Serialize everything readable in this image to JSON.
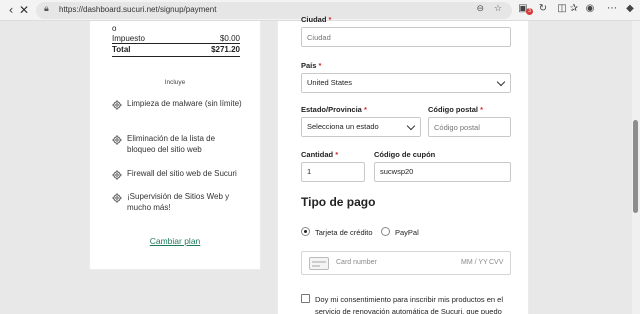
{
  "browser": {
    "url": "https://dashboard.sucuri.net/signup/payment",
    "notification_count": "3"
  },
  "summary": {
    "partial_top": "o",
    "tax_label": "Impuesto",
    "tax_value": "$0.00",
    "total_label": "Total",
    "total_value": "$271.20",
    "includes_label": "Incluye",
    "features": [
      {
        "text": "Limpieza de malware (sin límite)"
      },
      {
        "text": "Eliminación de la lista de bloqueo del sitio web"
      },
      {
        "text": "Firewall del sitio web de Sucuri"
      },
      {
        "text": "¡Supervisión de Sitios Web y mucho más!"
      }
    ],
    "change_plan": "Cambiar plan"
  },
  "form": {
    "city_label": "Ciudad",
    "city_placeholder": "Ciudad",
    "country_label": "País",
    "country_value": "United States",
    "state_label": "Estado/Provincia",
    "state_value": "Selecciona un estado",
    "postal_label": "Código postal",
    "postal_placeholder": "Código postal",
    "quantity_label": "Cantidad",
    "quantity_value": "1",
    "coupon_label": "Código de cupón",
    "coupon_value": "sucwsp20",
    "payment_title": "Tipo de pago",
    "credit_card_label": "Tarjeta de crédito",
    "paypal_label": "PayPal",
    "card_number_placeholder": "Card number",
    "expiry_placeholder": "MM / YY",
    "cvv_placeholder": "CVV",
    "consent_text": "Doy mi consentimiento para inscribir mis productos en el servicio de renovación automática de Sucuri, que puedo"
  },
  "colors": {
    "link": "#1f7a5a",
    "required": "#d02b2b"
  }
}
